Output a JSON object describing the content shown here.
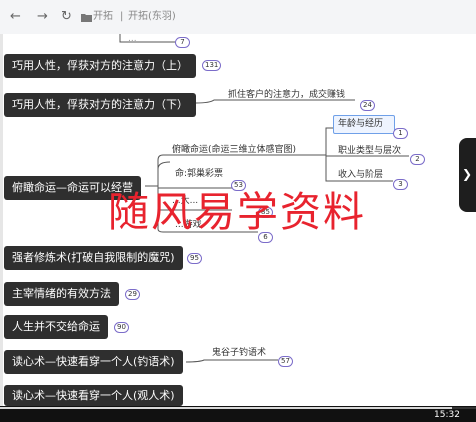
{
  "toolbar": {
    "back_icon": "back-arrow-icon",
    "forward_icon": "forward-arrow-icon",
    "refresh_icon": "refresh-icon",
    "folder_icon": "folder-icon",
    "breadcrumb_1": "开拓",
    "separator": "|",
    "breadcrumb_2": "开拓(东羽)"
  },
  "nodes": [
    {
      "label": "巧用人性，俘获对方的注意力（上）",
      "count": "131"
    },
    {
      "label": "巧用人性，俘获对方的注意力（下）",
      "count": "24"
    },
    {
      "label": "俯瞰命运—命运可以经营",
      "count": "53"
    },
    {
      "label": "强者修炼术(打破自我限制的魔咒)",
      "count": "95"
    },
    {
      "label": "主宰情绪的有效方法",
      "count": "29"
    },
    {
      "label": "人生并不交给命运",
      "count": "90"
    },
    {
      "label": "读心术—快速看穿一个人(钓语术)",
      "count": "57"
    },
    {
      "label": "读心术—快速看穿一个人(观人术)",
      "count": ""
    }
  ],
  "subnodes": {
    "top_partial_text": "...",
    "top_badge": "7",
    "attention_sub": "抓住客户的注意力，成交赚钱",
    "fate_sub_1": "俯瞰命运(命运三维立体感官图)",
    "fate_sub_2": "命:郭巢彩票",
    "fate_sub_3": "...大...",
    "fate_sub_4": "...游戏",
    "fate_badge_1": "85",
    "fate_badge_2": "6",
    "age": "年龄与经历",
    "age_badge": "1",
    "career": "职业类型与层次",
    "career_badge": "2",
    "income": "收入与阶层",
    "income_badge": "3",
    "ghost": "鬼谷子钓语术"
  },
  "watermark": "随风易学资料",
  "video": {
    "time": "15:32",
    "progress": 0.95
  }
}
